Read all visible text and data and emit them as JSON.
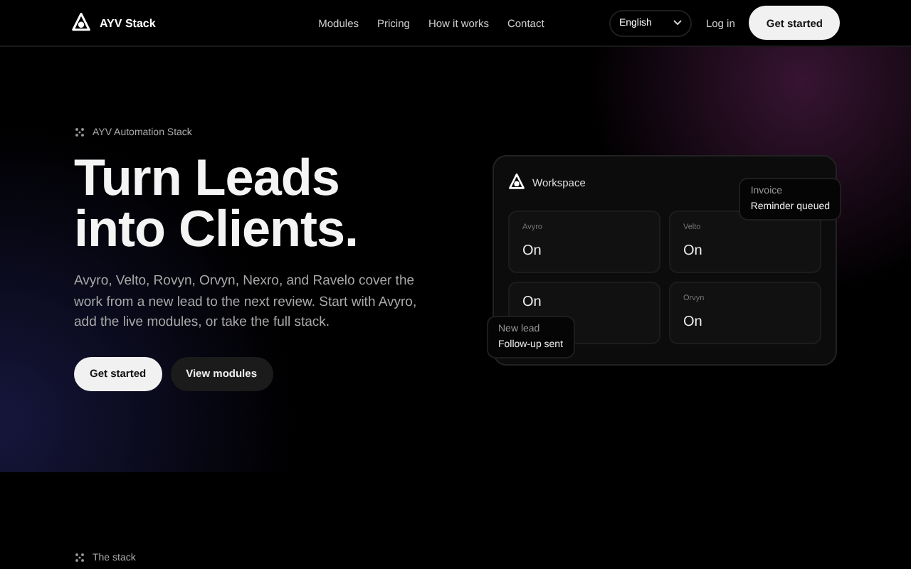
{
  "nav": {
    "brand": "AYV Stack",
    "links": [
      "Modules",
      "Pricing",
      "How it works",
      "Contact"
    ],
    "language": "English",
    "login": "Log in",
    "cta": "Get started"
  },
  "hero": {
    "eyebrow": "AYV Automation Stack",
    "title_lines": [
      "Turn Leads",
      "into Clients."
    ],
    "body": "Avyro, Velto, Rovyn, Orvyn, Nexro, and Ravelo cover the work from a new lead to the next review. Start with Avyro, add the live modules, or take the full stack.",
    "buttons": [
      {
        "label": "Get started",
        "kind": "primary"
      },
      {
        "label": "View modules",
        "kind": "secondary"
      }
    ]
  },
  "workspace": {
    "title": "Workspace",
    "cards": [
      {
        "label": "Avyro",
        "status": "On"
      },
      {
        "label": "Velto",
        "status": "On"
      },
      {
        "status": "On"
      },
      {
        "label": "Orvyn",
        "status": "On"
      }
    ],
    "toasts": [
      {
        "title": "Invoice",
        "message": "Reminder queued"
      },
      {
        "title": "New lead",
        "message": "Follow-up sent"
      }
    ]
  },
  "stack_section": {
    "eyebrow": "The stack"
  }
}
